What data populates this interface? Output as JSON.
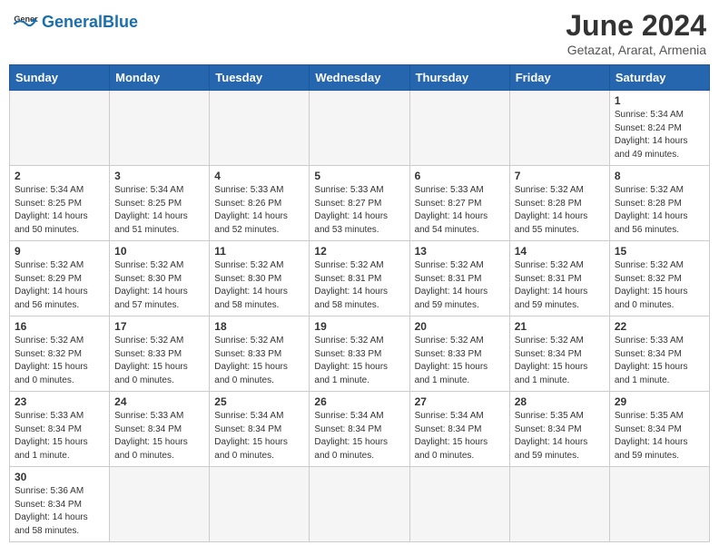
{
  "header": {
    "logo_general": "General",
    "logo_blue": "Blue",
    "month_title": "June 2024",
    "subtitle": "Getazat, Ararat, Armenia"
  },
  "weekdays": [
    "Sunday",
    "Monday",
    "Tuesday",
    "Wednesday",
    "Thursday",
    "Friday",
    "Saturday"
  ],
  "weeks": [
    [
      {
        "day": "",
        "info": ""
      },
      {
        "day": "",
        "info": ""
      },
      {
        "day": "",
        "info": ""
      },
      {
        "day": "",
        "info": ""
      },
      {
        "day": "",
        "info": ""
      },
      {
        "day": "",
        "info": ""
      },
      {
        "day": "1",
        "info": "Sunrise: 5:34 AM\nSunset: 8:24 PM\nDaylight: 14 hours\nand 49 minutes."
      }
    ],
    [
      {
        "day": "2",
        "info": "Sunrise: 5:34 AM\nSunset: 8:25 PM\nDaylight: 14 hours\nand 50 minutes."
      },
      {
        "day": "3",
        "info": "Sunrise: 5:34 AM\nSunset: 8:25 PM\nDaylight: 14 hours\nand 51 minutes."
      },
      {
        "day": "4",
        "info": "Sunrise: 5:33 AM\nSunset: 8:26 PM\nDaylight: 14 hours\nand 52 minutes."
      },
      {
        "day": "5",
        "info": "Sunrise: 5:33 AM\nSunset: 8:27 PM\nDaylight: 14 hours\nand 53 minutes."
      },
      {
        "day": "6",
        "info": "Sunrise: 5:33 AM\nSunset: 8:27 PM\nDaylight: 14 hours\nand 54 minutes."
      },
      {
        "day": "7",
        "info": "Sunrise: 5:32 AM\nSunset: 8:28 PM\nDaylight: 14 hours\nand 55 minutes."
      },
      {
        "day": "8",
        "info": "Sunrise: 5:32 AM\nSunset: 8:28 PM\nDaylight: 14 hours\nand 56 minutes."
      }
    ],
    [
      {
        "day": "9",
        "info": "Sunrise: 5:32 AM\nSunset: 8:29 PM\nDaylight: 14 hours\nand 56 minutes."
      },
      {
        "day": "10",
        "info": "Sunrise: 5:32 AM\nSunset: 8:30 PM\nDaylight: 14 hours\nand 57 minutes."
      },
      {
        "day": "11",
        "info": "Sunrise: 5:32 AM\nSunset: 8:30 PM\nDaylight: 14 hours\nand 58 minutes."
      },
      {
        "day": "12",
        "info": "Sunrise: 5:32 AM\nSunset: 8:31 PM\nDaylight: 14 hours\nand 58 minutes."
      },
      {
        "day": "13",
        "info": "Sunrise: 5:32 AM\nSunset: 8:31 PM\nDaylight: 14 hours\nand 59 minutes."
      },
      {
        "day": "14",
        "info": "Sunrise: 5:32 AM\nSunset: 8:31 PM\nDaylight: 14 hours\nand 59 minutes."
      },
      {
        "day": "15",
        "info": "Sunrise: 5:32 AM\nSunset: 8:32 PM\nDaylight: 15 hours\nand 0 minutes."
      }
    ],
    [
      {
        "day": "16",
        "info": "Sunrise: 5:32 AM\nSunset: 8:32 PM\nDaylight: 15 hours\nand 0 minutes."
      },
      {
        "day": "17",
        "info": "Sunrise: 5:32 AM\nSunset: 8:33 PM\nDaylight: 15 hours\nand 0 minutes."
      },
      {
        "day": "18",
        "info": "Sunrise: 5:32 AM\nSunset: 8:33 PM\nDaylight: 15 hours\nand 0 minutes."
      },
      {
        "day": "19",
        "info": "Sunrise: 5:32 AM\nSunset: 8:33 PM\nDaylight: 15 hours\nand 1 minute."
      },
      {
        "day": "20",
        "info": "Sunrise: 5:32 AM\nSunset: 8:33 PM\nDaylight: 15 hours\nand 1 minute."
      },
      {
        "day": "21",
        "info": "Sunrise: 5:32 AM\nSunset: 8:34 PM\nDaylight: 15 hours\nand 1 minute."
      },
      {
        "day": "22",
        "info": "Sunrise: 5:33 AM\nSunset: 8:34 PM\nDaylight: 15 hours\nand 1 minute."
      }
    ],
    [
      {
        "day": "23",
        "info": "Sunrise: 5:33 AM\nSunset: 8:34 PM\nDaylight: 15 hours\nand 1 minute."
      },
      {
        "day": "24",
        "info": "Sunrise: 5:33 AM\nSunset: 8:34 PM\nDaylight: 15 hours\nand 0 minutes."
      },
      {
        "day": "25",
        "info": "Sunrise: 5:34 AM\nSunset: 8:34 PM\nDaylight: 15 hours\nand 0 minutes."
      },
      {
        "day": "26",
        "info": "Sunrise: 5:34 AM\nSunset: 8:34 PM\nDaylight: 15 hours\nand 0 minutes."
      },
      {
        "day": "27",
        "info": "Sunrise: 5:34 AM\nSunset: 8:34 PM\nDaylight: 15 hours\nand 0 minutes."
      },
      {
        "day": "28",
        "info": "Sunrise: 5:35 AM\nSunset: 8:34 PM\nDaylight: 14 hours\nand 59 minutes."
      },
      {
        "day": "29",
        "info": "Sunrise: 5:35 AM\nSunset: 8:34 PM\nDaylight: 14 hours\nand 59 minutes."
      }
    ],
    [
      {
        "day": "30",
        "info": "Sunrise: 5:36 AM\nSunset: 8:34 PM\nDaylight: 14 hours\nand 58 minutes."
      },
      {
        "day": "",
        "info": ""
      },
      {
        "day": "",
        "info": ""
      },
      {
        "day": "",
        "info": ""
      },
      {
        "day": "",
        "info": ""
      },
      {
        "day": "",
        "info": ""
      },
      {
        "day": "",
        "info": ""
      }
    ]
  ]
}
